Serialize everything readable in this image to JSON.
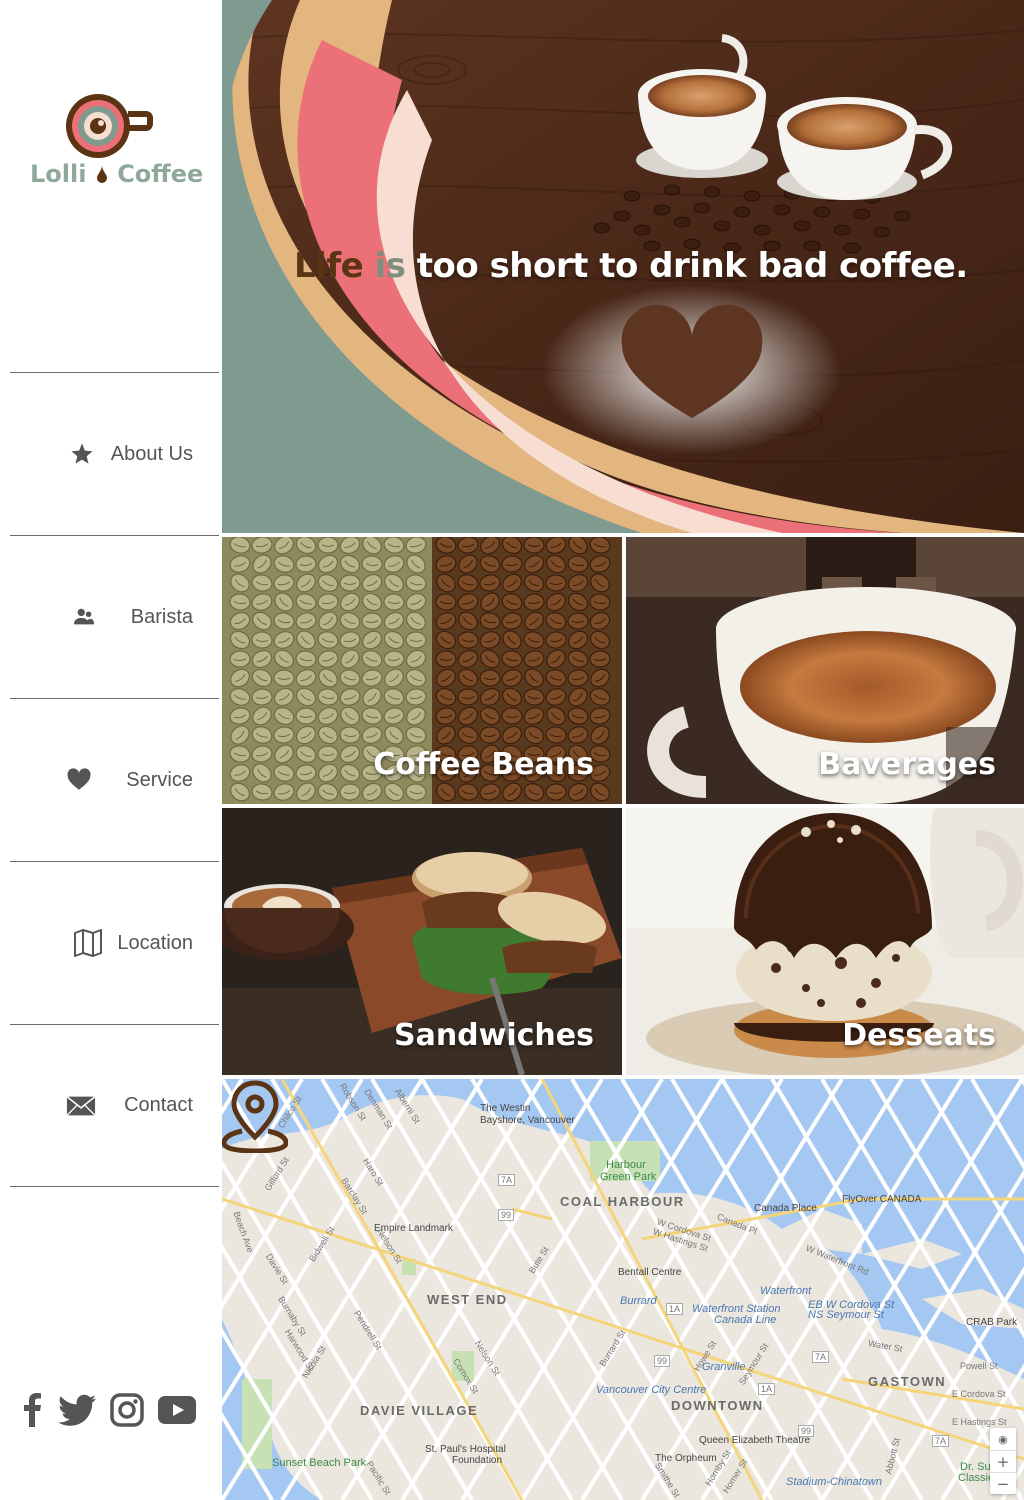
{
  "brand": {
    "name_part1": "Lolli",
    "name_part2": "Coffee",
    "colors": {
      "pink": "#ec7077",
      "peach": "#f7ddd2",
      "sage": "#7f9a8e",
      "tan": "#e3b57f",
      "brown": "#5a3413"
    }
  },
  "hero": {
    "tagline_word1": "Life",
    "tagline_word2": "is",
    "tagline_rest": "too short to drink bad coffee."
  },
  "nav": {
    "items": [
      {
        "label": "About Us",
        "icon": "star-icon"
      },
      {
        "label": "Barista",
        "icon": "users-icon"
      },
      {
        "label": "Service",
        "icon": "heart-icon"
      },
      {
        "label": "Location",
        "icon": "map-icon"
      },
      {
        "label": "Contact",
        "icon": "envelope-icon"
      }
    ]
  },
  "tiles": [
    {
      "label": "Coffee Beans"
    },
    {
      "label": "Baverages"
    },
    {
      "label": "Sandwiches"
    },
    {
      "label": "Desseats"
    }
  ],
  "social": [
    "facebook-icon",
    "twitter-icon",
    "instagram-icon",
    "youtube-icon"
  ],
  "map": {
    "areas": [
      "COAL HARBOUR",
      "WEST END",
      "DAVIE VILLAGE",
      "DOWNTOWN",
      "GASTOWN"
    ],
    "places": {
      "westin": "The Westin",
      "westin2": "Bayshore, Vancouver",
      "harbour_green": "Harbour",
      "harbour_green2": "Green Park",
      "canada_place": "Canada Place",
      "flyover": "FlyOver CANADA",
      "empire": "Empire Landmark",
      "bentall": "Bentall Centre",
      "waterfront": "Waterfront",
      "waterfront_station": "Waterfront Station",
      "canada_line": "Canada Line",
      "eb_cordova": "EB W Cordova St",
      "ns_seymour": "NS Seymour St",
      "burrard": "Burrard",
      "granville": "Granville",
      "vcc": "Vancouver City Centre",
      "qe_theatre": "Queen Elizabeth Theatre",
      "orpheum": "The Orpheum",
      "st_pauls": "St. Paul's Hospital",
      "st_pauls2": "Foundation",
      "sunset": "Sunset Beach Park",
      "crab": "CRAB Park",
      "stadium": "Stadium-Chinatown",
      "dr_sun": "Dr. Sun Y",
      "dr_sun2": "Classical"
    },
    "streets": [
      "Robson St",
      "Denman St",
      "Alberni St",
      "Chilco St",
      "Gilford St",
      "Haro St",
      "Barclay St",
      "Bidwell St",
      "Davie St",
      "Nelson St",
      "Jervis St",
      "Burnaby St",
      "Harwood St",
      "Nicola St",
      "Pendrell St",
      "Comox St",
      "Bute St",
      "Burrard St",
      "Howe St",
      "Seymour St",
      "Hornby St",
      "Homer St",
      "Pacific St",
      "Smithe St",
      "W Cordova St",
      "W Hastings St",
      "W Waterfront Rd",
      "Canada Pl",
      "Water St",
      "Powell St",
      "E Cordova St",
      "E Hastings St",
      "Abbott St",
      "Beach Ave"
    ],
    "routes": [
      "7A",
      "99",
      "1A",
      "99",
      "7A",
      "1A",
      "99",
      "7A"
    ],
    "zoom_in": "+",
    "zoom_out": "−",
    "locate": "◉"
  }
}
